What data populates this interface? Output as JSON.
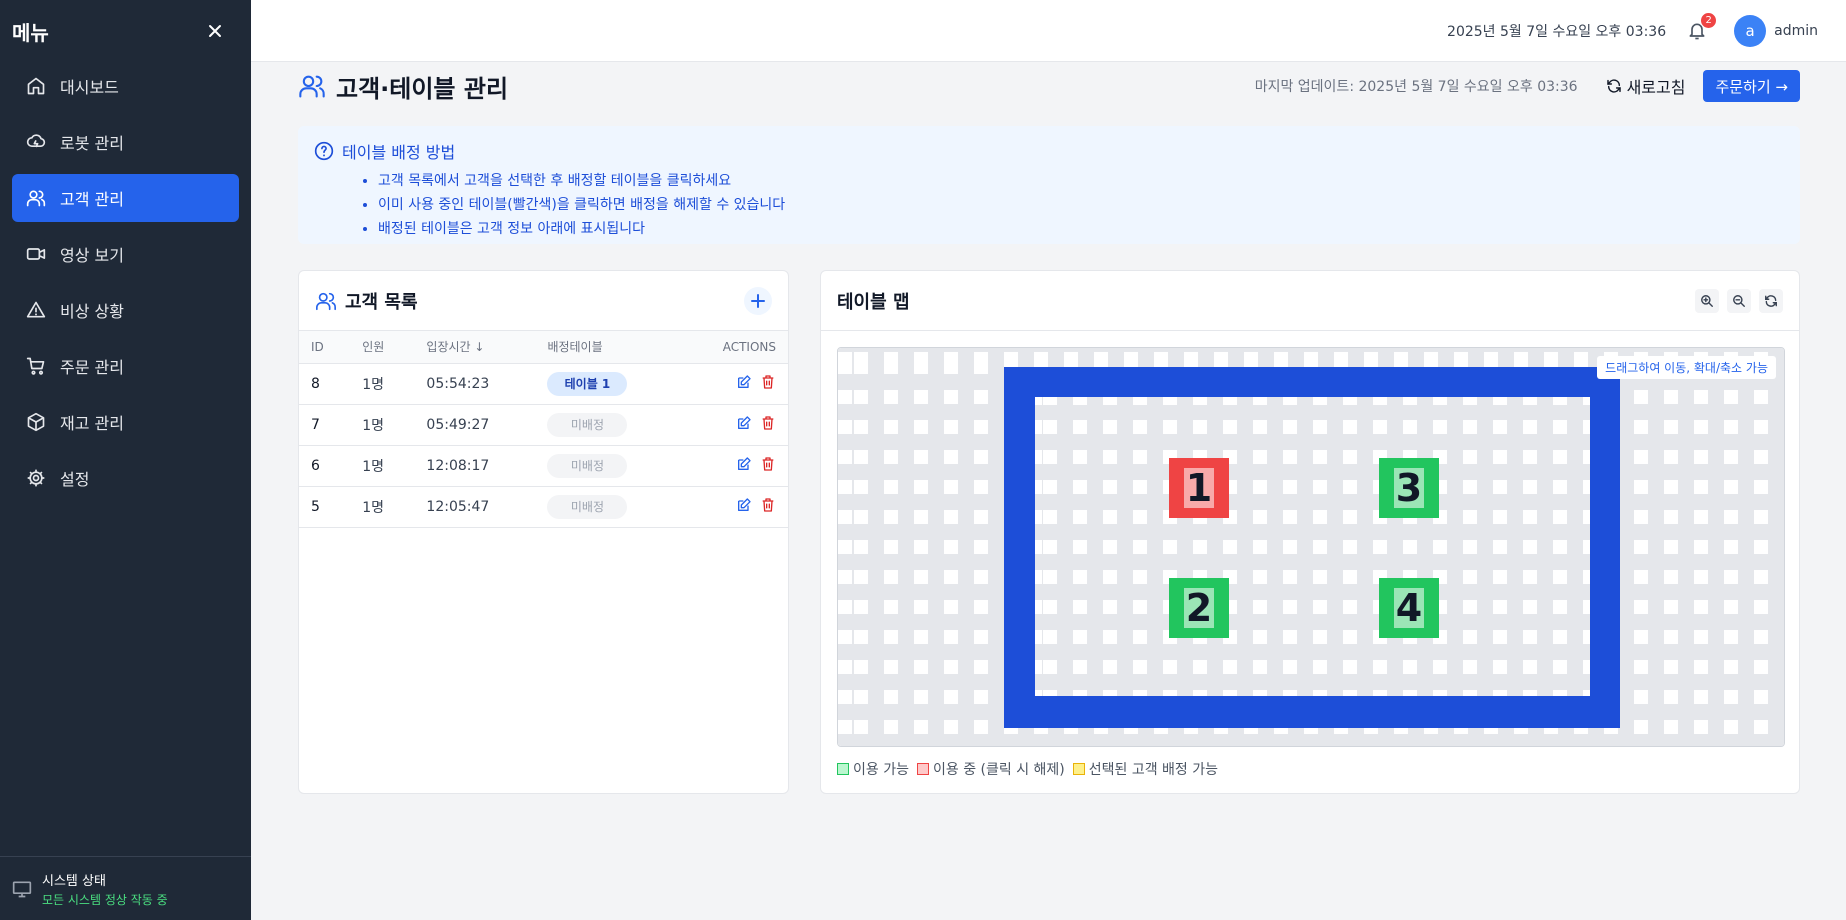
{
  "sidebar": {
    "title": "메뉴",
    "items": [
      {
        "label": "대시보드",
        "icon": "home-icon"
      },
      {
        "label": "로봇 관리",
        "icon": "robot-icon"
      },
      {
        "label": "고객 관리",
        "icon": "users-icon",
        "active": true
      },
      {
        "label": "영상 보기",
        "icon": "video-icon"
      },
      {
        "label": "비상 상황",
        "icon": "alert-icon"
      },
      {
        "label": "주문 관리",
        "icon": "cart-icon"
      },
      {
        "label": "재고 관리",
        "icon": "box-icon"
      },
      {
        "label": "설정",
        "icon": "gear-icon"
      }
    ],
    "status_title": "시스템 상태",
    "status_sub": "모든 시스템 정상 작동 중"
  },
  "topbar": {
    "datetime": "2025년 5월 7일 수요일 오후 03:36",
    "notification_count": "2",
    "avatar_letter": "a",
    "username": "admin"
  },
  "page": {
    "title": "고객·테이블 관리",
    "last_updated": "마지막 업데이트: 2025년 5월 7일 수요일 오후 03:36",
    "refresh_label": "새로고침",
    "order_label": "주문하기 →"
  },
  "info": {
    "title": "테이블 배정 방법",
    "bullets": [
      "고객 목록에서 고객을 선택한 후 배정할 테이블을 클릭하세요",
      "이미 사용 중인 테이블(빨간색)을 클릭하면 배정을 해제할 수 있습니다",
      "배정된 테이블은 고객 정보 아래에 표시됩니다"
    ]
  },
  "customers": {
    "title": "고객 목록",
    "columns": [
      "ID",
      "인원",
      "입장시간 ↓",
      "배정테이블",
      "ACTIONS"
    ],
    "rows": [
      {
        "id": "8",
        "people": "1명",
        "time": "05:54:23",
        "table": "테이블 1",
        "assigned": true
      },
      {
        "id": "7",
        "people": "1명",
        "time": "05:49:27",
        "table": "미배정",
        "assigned": false
      },
      {
        "id": "6",
        "people": "1명",
        "time": "12:08:17",
        "table": "미배정",
        "assigned": false
      },
      {
        "id": "5",
        "people": "1명",
        "time": "12:05:47",
        "table": "미배정",
        "assigned": false
      }
    ]
  },
  "map": {
    "title": "테이블 맵",
    "hint": "드래그하여 이동, 확대/축소 가능",
    "tables": [
      {
        "number": "1",
        "status": "used"
      },
      {
        "number": "3",
        "status": "free"
      },
      {
        "number": "2",
        "status": "free"
      },
      {
        "number": "4",
        "status": "free"
      }
    ],
    "legend": [
      {
        "label": "이용 가능",
        "color": "#22c55e"
      },
      {
        "label": "이용 중 (클릭 시 해제)",
        "color": "#ef4444"
      },
      {
        "label": "선택된 고객 배정 가능",
        "color": "#facc15"
      }
    ],
    "colors": {
      "wall": "#1d4ed8",
      "used": "#ef4444",
      "free": "#22c55e"
    }
  }
}
